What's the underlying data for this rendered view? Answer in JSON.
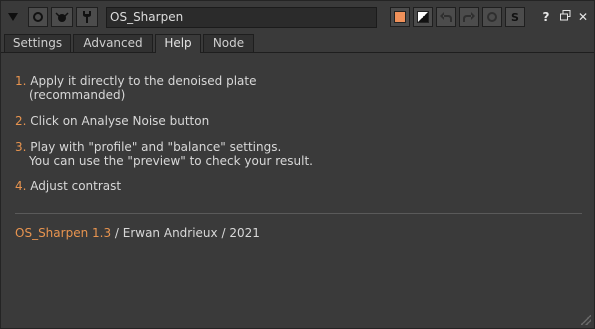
{
  "toolbar": {
    "node_name": "OS_Sharpen",
    "icons": [
      "collapse-arrow-icon",
      "view-node-icon",
      "bug-icon",
      "wrench-icon",
      "node-color-swatch",
      "hide-input-icon",
      "undo-icon",
      "redo-icon",
      "revert-icon",
      "script-icon",
      "help-icon",
      "float-panel-icon",
      "close-icon"
    ],
    "swatch_color": "#f0915a",
    "script_label": "S",
    "help_label": "?",
    "close_label": "✕"
  },
  "tabs": [
    {
      "label": "Settings",
      "active": false
    },
    {
      "label": "Advanced",
      "active": false
    },
    {
      "label": "Help",
      "active": true
    },
    {
      "label": "Node",
      "active": false
    }
  ],
  "help": {
    "steps": [
      {
        "num": "1.",
        "lines": [
          "Apply it directly to the denoised plate",
          "(recommanded)"
        ]
      },
      {
        "num": "2.",
        "lines": [
          "Click on Analyse Noise button"
        ]
      },
      {
        "num": "3.",
        "lines": [
          "Play with \"profile\" and \"balance\" settings.",
          "You can use the \"preview\" to check your result."
        ]
      },
      {
        "num": "4.",
        "lines": [
          "Adjust contrast"
        ]
      }
    ],
    "footer": {
      "name": "OS_Sharpen 1.3",
      "rest": " / Erwan Andrieux / 2021"
    }
  },
  "colors": {
    "accent": "#e8944f",
    "background": "#3a3a3a"
  }
}
